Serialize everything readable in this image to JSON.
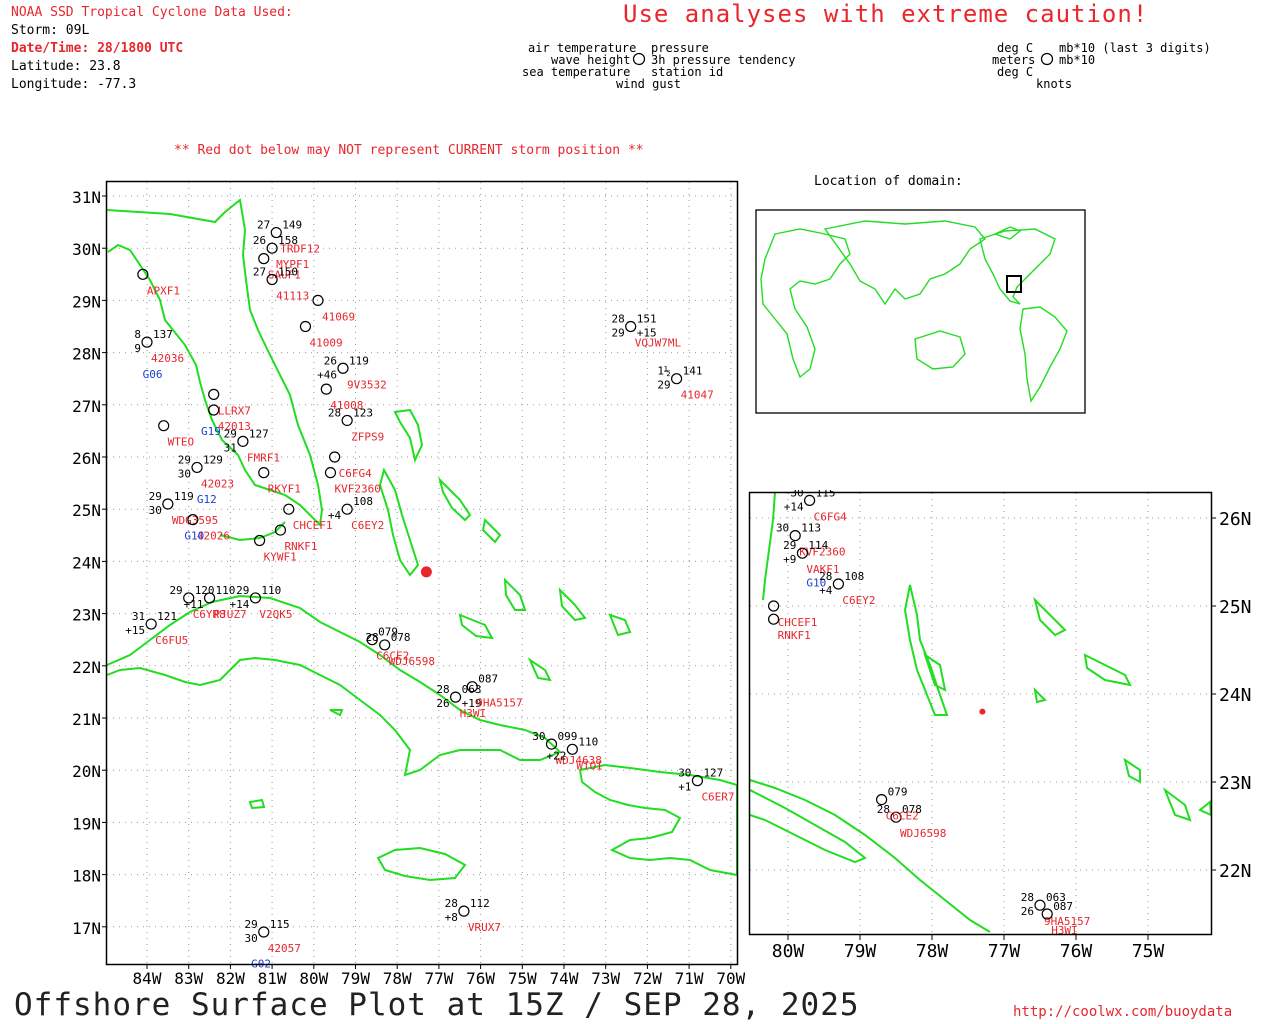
{
  "header": {
    "line1": "NOAA SSD Tropical Cyclone Data Used:",
    "storm": "Storm: 09L",
    "datetime": "Date/Time: 28/1800 UTC",
    "latitude": "Latitude: 23.8",
    "longitude": "Longitude: -77.3"
  },
  "caution": "Use analyses with extreme caution!",
  "legend": {
    "left_top": "air temperature",
    "left_mid": "wave height",
    "left_bot": "sea temperature",
    "right_top": "pressure",
    "right_mid": "3h pressure tendency",
    "right_bot": "station id",
    "gust": "wind gust",
    "units_left_top": "deg C",
    "units_left_mid": "meters",
    "units_left_bot": "deg C",
    "units_right_top": "mb*10 (last 3 digits)",
    "units_right_mid": "mb*10",
    "units_gust": "knots"
  },
  "note": "** Red dot below may NOT represent CURRENT storm position **",
  "domain_label": "Location of domain:",
  "title": "Offshore Surface Plot at 15Z / SEP 28, 2025",
  "url": "http://coolwx.com/buoydata",
  "colors": {
    "land": "#22dd22",
    "storm": "#e8262c",
    "station": "#1a3fd6",
    "grid": "#999999"
  },
  "main_map": {
    "lat_labels": [
      "31N",
      "30N",
      "29N",
      "28N",
      "27N",
      "26N",
      "25N",
      "24N",
      "23N",
      "22N",
      "21N",
      "20N",
      "19N",
      "18N",
      "17N"
    ],
    "lon_labels": [
      "84W",
      "83W",
      "82W",
      "81W",
      "80W",
      "79W",
      "78W",
      "77W",
      "76W",
      "75W",
      "74W",
      "73W",
      "72W",
      "71W",
      "70W"
    ]
  },
  "inset_map": {
    "lat_labels": [
      "26N",
      "25N",
      "24N",
      "23N",
      "22N"
    ],
    "lon_labels": [
      "80W",
      "79W",
      "78W",
      "77W",
      "76W",
      "75W"
    ]
  },
  "stations": [
    {
      "id": "APXF1",
      "lon": -84.1,
      "lat": 29.5,
      "color": "red"
    },
    {
      "id": "42036",
      "lon": -84.0,
      "lat": 28.2,
      "color": "red",
      "t": "8",
      "p": "137",
      "d": "9"
    },
    {
      "id": "G06",
      "lon": -84.2,
      "lat": 27.9,
      "color": "blue"
    },
    {
      "id": "WTEO",
      "lon": -83.6,
      "lat": 26.6,
      "color": "red"
    },
    {
      "id": "42023",
      "lon": -82.8,
      "lat": 25.8,
      "color": "red",
      "t": "29",
      "p": "129",
      "d": "30"
    },
    {
      "id": "G12",
      "lon": -82.9,
      "lat": 25.5,
      "color": "blue"
    },
    {
      "id": "WDG3595",
      "lon": -83.5,
      "lat": 25.1,
      "color": "red",
      "t": "29",
      "p": "119",
      "d": "30"
    },
    {
      "id": "42026",
      "lon": -82.9,
      "lat": 24.8,
      "color": "red"
    },
    {
      "id": "G10",
      "lon": -83.2,
      "lat": 24.8,
      "color": "blue"
    },
    {
      "id": "G19",
      "lon": -82.8,
      "lat": 26.8,
      "color": "blue"
    },
    {
      "id": "42013",
      "lon": -82.4,
      "lat": 26.9,
      "color": "red"
    },
    {
      "id": "LLRX7",
      "lon": -82.4,
      "lat": 27.2,
      "color": "red"
    },
    {
      "id": "FMRF1",
      "lon": -81.7,
      "lat": 26.3,
      "color": "red",
      "t": "29",
      "p": "127",
      "d": "31"
    },
    {
      "id": "RKYF1",
      "lon": -81.2,
      "lat": 25.7,
      "color": "red"
    },
    {
      "id": "C6YR8",
      "lon": -83.0,
      "lat": 23.3,
      "color": "red",
      "t": "29",
      "p": "120"
    },
    {
      "id": "PJUZ7",
      "lon": -82.5,
      "lat": 23.3,
      "color": "red",
      "p": "110",
      "d": "+11"
    },
    {
      "id": "V2QK5",
      "lon": -81.4,
      "lat": 23.3,
      "color": "red",
      "t": "29",
      "p": "110",
      "d": "+14"
    },
    {
      "id": "C6FU5",
      "lon": -83.9,
      "lat": 22.8,
      "color": "red",
      "t": "31",
      "p": "121",
      "d": "+15"
    },
    {
      "id": "42057",
      "lon": -81.2,
      "lat": 16.9,
      "color": "red",
      "t": "29",
      "p": "115",
      "d": "30"
    },
    {
      "id": "G02",
      "lon": -81.6,
      "lat": 16.6,
      "color": "blue"
    },
    {
      "id": "41009",
      "lon": -80.2,
      "lat": 28.5,
      "color": "red"
    },
    {
      "id": "41069",
      "lon": -79.9,
      "lat": 29.0,
      "color": "red"
    },
    {
      "id": "9V3532",
      "lon": -79.3,
      "lat": 27.7,
      "color": "red",
      "t": "26",
      "p": "119",
      "d": "+46"
    },
    {
      "id": "41008",
      "lon": -79.7,
      "lat": 27.3,
      "color": "red"
    },
    {
      "id": "ZFPS9",
      "lon": -79.2,
      "lat": 26.7,
      "color": "red",
      "t": "28",
      "p": "123"
    },
    {
      "id": "C6FG4",
      "lon": -79.5,
      "lat": 26.0,
      "color": "red"
    },
    {
      "id": "KVF2360",
      "lon": -79.6,
      "lat": 25.7,
      "color": "red"
    },
    {
      "id": "C6EY2",
      "lon": -79.2,
      "lat": 25.0,
      "color": "red",
      "p": "108",
      "d": "+4"
    },
    {
      "id": "VQJW7ML",
      "lon": -72.4,
      "lat": 28.5,
      "color": "red",
      "t": "28",
      "p": "151",
      "d": "29",
      "q": "+15"
    },
    {
      "id": "41047",
      "lon": -71.3,
      "lat": 27.5,
      "color": "red",
      "t": "1½",
      "p": "141",
      "d": "29"
    },
    {
      "id": "H3WI",
      "lon": -76.6,
      "lat": 21.4,
      "color": "red",
      "t": "28",
      "p": "063",
      "d": "26",
      "q": "+19"
    },
    {
      "id": "9HA5157",
      "lon": -76.2,
      "lat": 21.6,
      "color": "red",
      "p": "087"
    },
    {
      "id": "WDJ6598",
      "lon": -78.3,
      "lat": 22.4,
      "color": "red",
      "t": "28",
      "p": "078"
    },
    {
      "id": "C6CE2",
      "lon": -78.6,
      "lat": 22.5,
      "color": "red",
      "p": "079"
    },
    {
      "id": "WDJ4638",
      "lon": -74.3,
      "lat": 20.5,
      "color": "red",
      "t": "30",
      "p": "099"
    },
    {
      "id": "WTOI",
      "lon": -73.8,
      "lat": 20.4,
      "color": "red",
      "p": "110",
      "d": "+22"
    },
    {
      "id": "C6ER7",
      "lon": -70.8,
      "lat": 19.8,
      "color": "red",
      "t": "30",
      "p": "127",
      "d": "+1"
    },
    {
      "id": "VRUX7",
      "lon": -76.4,
      "lat": 17.3,
      "color": "red",
      "t": "28",
      "p": "112",
      "d": "+8"
    },
    {
      "id": "RNKF1",
      "lon": -80.8,
      "lat": 24.6,
      "color": "red"
    },
    {
      "id": "CHCEF1",
      "lon": -80.6,
      "lat": 25.0,
      "color": "red"
    },
    {
      "id": "KYWF1",
      "lon": -81.3,
      "lat": 24.4,
      "color": "red"
    },
    {
      "id": "SAUF1",
      "lon": -81.2,
      "lat": 29.8,
      "color": "red"
    },
    {
      "id": "TRDF12",
      "lon": -80.9,
      "lat": 30.3,
      "color": "red",
      "t": "27",
      "p": "149"
    },
    {
      "id": "MYPF1",
      "lon": -81.0,
      "lat": 30.0,
      "color": "red",
      "t": "26",
      "p": "158"
    },
    {
      "id": "41113",
      "lon": -81.0,
      "lat": 29.4,
      "color": "red",
      "t": "27",
      "p": "150"
    }
  ],
  "inset_stations": [
    {
      "id": "C6FG4",
      "lon": -79.7,
      "lat": 26.2,
      "color": "red",
      "t": "30",
      "p": "115",
      "d": "+14"
    },
    {
      "id": "KVF2360",
      "lon": -79.9,
      "lat": 25.8,
      "color": "red",
      "t": "30",
      "p": "113"
    },
    {
      "id": "VAKF1",
      "lon": -79.8,
      "lat": 25.6,
      "color": "red",
      "t": "29",
      "p": "114",
      "d": "+9"
    },
    {
      "id": "G10",
      "lon": -79.8,
      "lat": 25.45,
      "color": "blue"
    },
    {
      "id": "C6EY2",
      "lon": -79.3,
      "lat": 25.25,
      "color": "red",
      "t": "28",
      "p": "108",
      "d": "+4"
    },
    {
      "id": "CHCEF1",
      "lon": -80.2,
      "lat": 25.0,
      "color": "red"
    },
    {
      "id": "RNKF1",
      "lon": -80.2,
      "lat": 24.85,
      "color": "red"
    },
    {
      "id": "WDJ6598",
      "lon": -78.5,
      "lat": 22.6,
      "color": "red",
      "t": "28",
      "p": "078"
    },
    {
      "id": "C6CE2",
      "lon": -78.7,
      "lat": 22.8,
      "color": "red",
      "p": "079"
    },
    {
      "id": "9HA5157",
      "lon": -76.5,
      "lat": 21.6,
      "color": "red",
      "t": "28",
      "p": "063",
      "d": "26"
    },
    {
      "id": "H3WI",
      "lon": -76.4,
      "lat": 21.5,
      "color": "red",
      "p": "087"
    }
  ],
  "storm_position": {
    "lon": -77.3,
    "lat": 23.8
  }
}
